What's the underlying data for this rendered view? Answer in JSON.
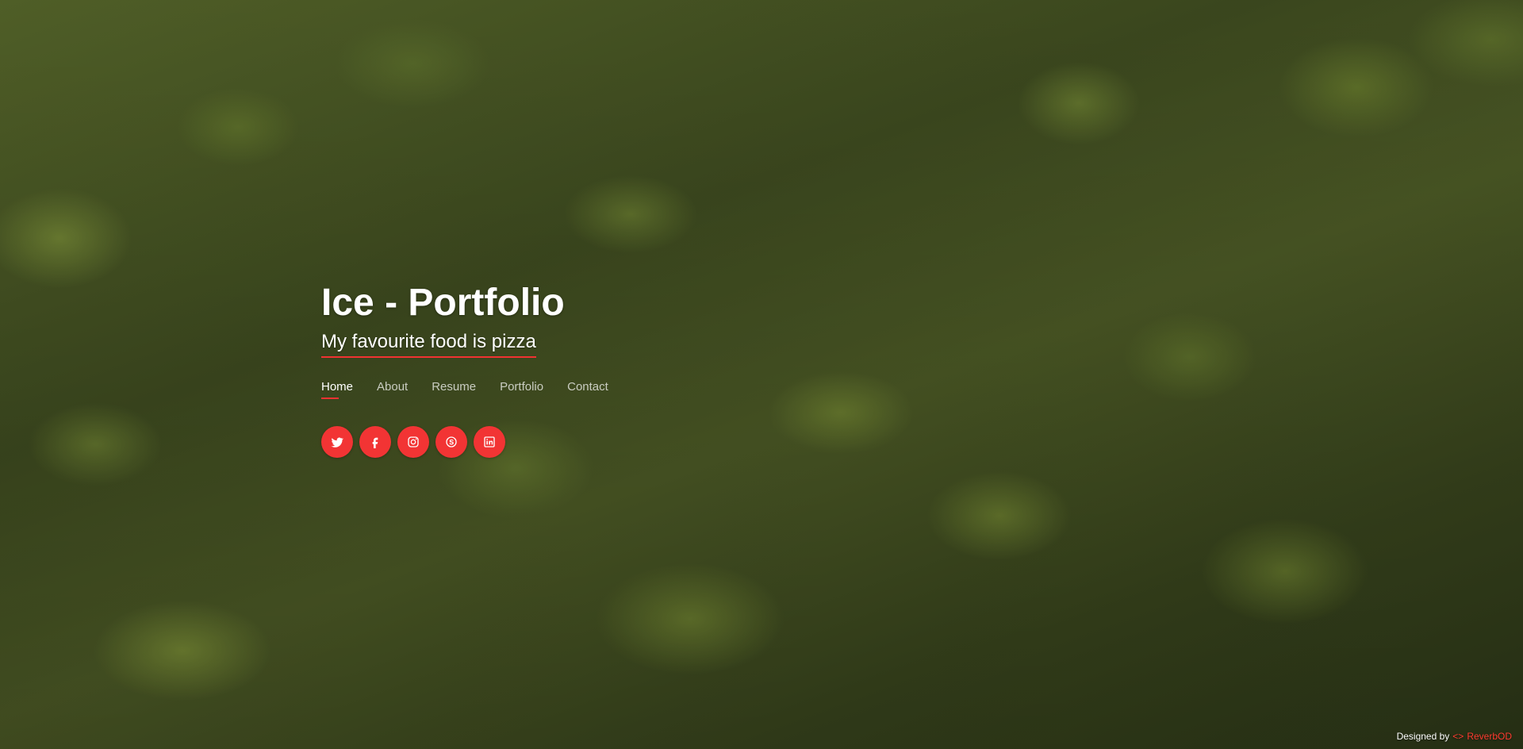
{
  "hero": {
    "title": "Ice - Portfolio",
    "subtitle": "My favourite food is pizza"
  },
  "nav": {
    "items": [
      {
        "label": "Home",
        "active": true
      },
      {
        "label": "About",
        "active": false
      },
      {
        "label": "Resume",
        "active": false
      },
      {
        "label": "Portfolio",
        "active": false
      },
      {
        "label": "Contact",
        "active": false
      }
    ]
  },
  "social": {
    "items": [
      {
        "icon": "twitter-icon"
      },
      {
        "icon": "facebook-icon"
      },
      {
        "icon": "instagram-icon"
      },
      {
        "icon": "skype-icon"
      },
      {
        "icon": "linkedin-icon"
      }
    ],
    "accent_color": "#f23434"
  },
  "footer": {
    "prefix": "Designed by",
    "icon": "code-icon",
    "icon_glyph": "<>",
    "author": "ReverbOD"
  },
  "colors": {
    "accent": "#f03232",
    "text": "#ffffff",
    "background_theme": "moss-green"
  }
}
